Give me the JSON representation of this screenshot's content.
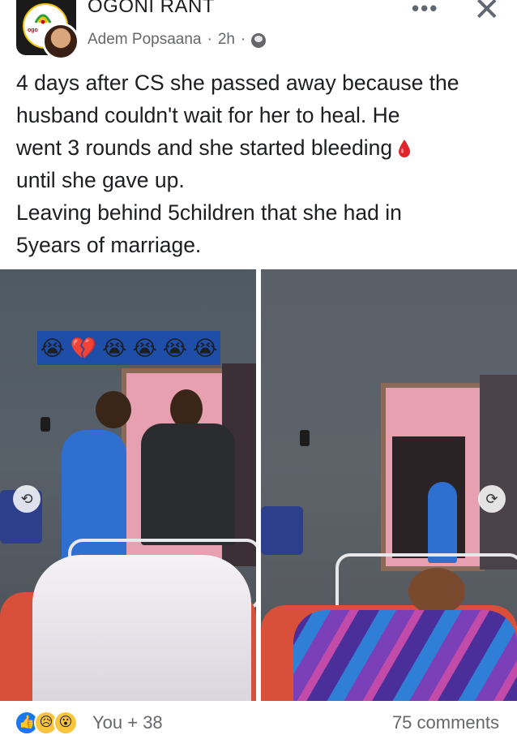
{
  "post": {
    "page_name": "OGONI RANT",
    "author": "Adem Popsaana",
    "separator": "·",
    "time": "2h",
    "text_lines": [
      "4 days after CS she passed away because the",
      "husband couldn't wait for her to heal. He",
      "went 3 rounds and she started bleeding",
      "until she gave up.",
      "Leaving behind 5children that she had in",
      "5years of marriage."
    ]
  },
  "icons": {
    "more": "more-horizontal-icon",
    "close": "close-icon",
    "audience": "globe-icon",
    "drop": "blood-drop-icon",
    "rotate_left": "rotate-icon",
    "rotate_right": "rotate-icon"
  },
  "photo_overlay": {
    "emoji_strip": [
      "😭",
      "💔",
      "😭",
      "😭",
      "😭",
      "😭"
    ]
  },
  "footer": {
    "reactions": [
      "👍",
      "😥",
      "😮"
    ],
    "reactors_label": "You + 38",
    "comments_label": "75 comments"
  },
  "colors": {
    "text": "#1c1e21",
    "secondary": "#65676b",
    "like_blue": "#1877f2",
    "blood_red": "#e0242b"
  }
}
